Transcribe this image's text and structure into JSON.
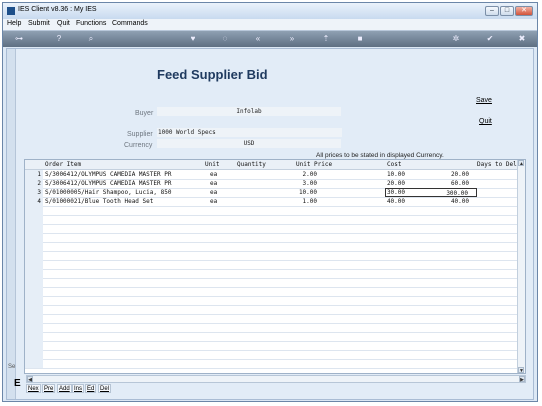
{
  "window": {
    "title": "IES Client v8.36 : My IES",
    "minimize": "–",
    "maximize": "□",
    "close": "✕"
  },
  "menu": {
    "items": [
      "Help",
      "Submit",
      "Quit",
      "Functions",
      "Commands"
    ]
  },
  "toolbar": {
    "icons": [
      "key-icon",
      "help-icon",
      "search-icon",
      "heart-icon",
      "power-icon",
      "rewind-icon",
      "fast-forward-icon",
      "upload-icon",
      "stop-icon",
      "settings-icon",
      "check-icon",
      "close-icon"
    ],
    "glyphs": [
      "⊶",
      "?",
      "⌕",
      "♥",
      "◌",
      "«",
      "»",
      "⇡",
      "■",
      "✲",
      "✔",
      "✖"
    ]
  },
  "form": {
    "title": "Feed Supplier Bid",
    "save": "Save",
    "quit": "Quit",
    "buyer_label": "Buyer",
    "buyer_value": "Infolab",
    "supplier_label": "Supplier",
    "supplier_value": "1000 World Specs",
    "currency_label": "Currency",
    "currency_value": "USD",
    "note": "All prices to be stated in displayed Currency."
  },
  "grid": {
    "headers": {
      "order_item": "Order Item",
      "unit": "Unit",
      "quantity": "Quantity",
      "unit_price": "Unit Price",
      "cost": "Cost",
      "days": "Days to Del"
    },
    "rows": [
      {
        "n": "1",
        "item": "S/3006412/OLYMPUS CAMEDIA MASTER PR",
        "unit": "ea",
        "qty": "2.00",
        "price": "10.00",
        "cost": "20.00"
      },
      {
        "n": "2",
        "item": "S/3006412/OLYMPUS CAMEDIA MASTER PR",
        "unit": "ea",
        "qty": "3.00",
        "price": "20.00",
        "cost": "60.00"
      },
      {
        "n": "3",
        "item": "S/01000005/Hair Shampoo, Lucia, 850",
        "unit": "ea",
        "qty": "10.00",
        "price": "30.00",
        "cost": "300.00"
      },
      {
        "n": "4",
        "item": "S/01000021/Blue Tooth Head Set",
        "unit": "ea",
        "qty": "1.00",
        "price": "40.00",
        "cost": "40.00"
      }
    ]
  },
  "bottom": {
    "buttons": [
      "Nex",
      "Pre",
      "Add",
      "Ins",
      "Ed",
      "Del"
    ],
    "side_letter": "E",
    "side_label": "Se"
  }
}
